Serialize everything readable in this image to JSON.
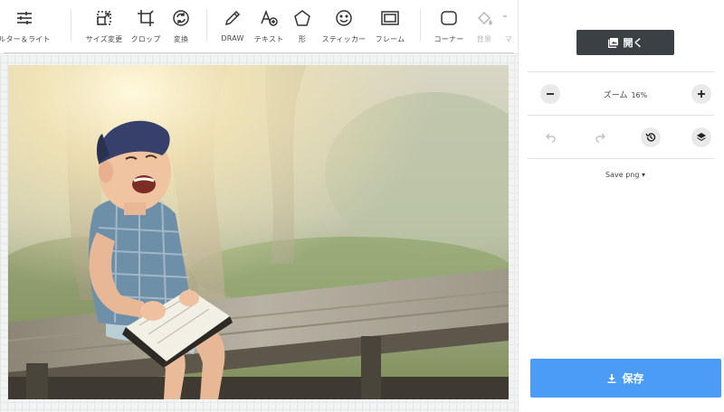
{
  "toolbar": {
    "tools": [
      {
        "label": "ルター＆ライト",
        "icon": "sliders-icon"
      },
      {
        "label": "サイズ変更",
        "icon": "resize-icon"
      },
      {
        "label": "クロップ",
        "icon": "crop-icon"
      },
      {
        "label": "変換",
        "icon": "transform-icon"
      },
      {
        "label": "DRAW",
        "icon": "pencil-icon"
      },
      {
        "label": "テキスト",
        "icon": "text-icon"
      },
      {
        "label": "形",
        "icon": "shape-icon"
      },
      {
        "label": "スティッカー",
        "icon": "sticker-icon"
      },
      {
        "label": "フレーム",
        "icon": "frame-icon"
      },
      {
        "label": "コーナー",
        "icon": "corner-icon"
      },
      {
        "label": "背景",
        "icon": "fill-icon"
      },
      {
        "label": "マ",
        "icon": "more-icon"
      }
    ]
  },
  "panel": {
    "open_label": "開く",
    "zoom_label": "ズーム",
    "zoom_value": "16%",
    "save_format": "Save png",
    "save_label": "保存"
  },
  "colors": {
    "accent": "#4b9cf5",
    "dark_button": "#3b4045"
  }
}
